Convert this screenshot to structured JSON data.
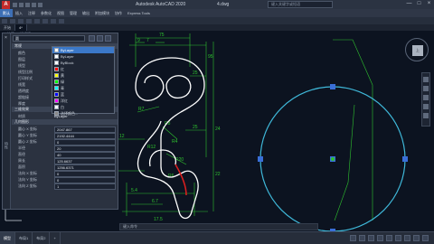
{
  "window": {
    "logo": "A",
    "title": "Autodesk AutoCAD 2020",
    "file": "4.dwg",
    "search_placeholder": "键入关键字或短语",
    "minimize": "—",
    "maximize": "□",
    "close": "×"
  },
  "menu": {
    "items": [
      "默认",
      "插入",
      "注释",
      "参数化",
      "视图",
      "管理",
      "输出",
      "附加模块",
      "协作",
      "Express Tools"
    ],
    "active_index": 0
  },
  "doc_tabs": [
    {
      "label": "开始",
      "active": false
    },
    {
      "label": "4*",
      "active": true
    }
  ],
  "viewport_label": "[-][俯视][二维线框]",
  "properties": {
    "close": "×",
    "side_title": "特性",
    "selection": "圆",
    "sections": {
      "general": "常规",
      "threed": "三维效果",
      "geometry": "几何图形"
    },
    "general_rows": [
      {
        "key": "颜色",
        "value": "ByLayer"
      },
      {
        "key": "图层",
        "value": ""
      },
      {
        "key": "线型",
        "value": ""
      },
      {
        "key": "线型比例",
        "value": ""
      },
      {
        "key": "打印样式",
        "value": ""
      },
      {
        "key": "线宽",
        "value": ""
      },
      {
        "key": "透明度",
        "value": ""
      },
      {
        "key": "超链接",
        "value": ""
      },
      {
        "key": "厚度",
        "value": ""
      }
    ],
    "threed_rows": [
      {
        "key": "材质",
        "value": "ByLayer"
      }
    ],
    "geometry_rows": [
      {
        "key": "圆心 X 坐标",
        "value": "2047.867"
      },
      {
        "key": "圆心 Y 坐标",
        "value": "2192.4444"
      },
      {
        "key": "圆心 Z 坐标",
        "value": "0"
      },
      {
        "key": "半径",
        "value": "20"
      },
      {
        "key": "直径",
        "value": "40"
      },
      {
        "key": "周长",
        "value": "125.6637"
      },
      {
        "key": "面积",
        "value": "1256.6371"
      },
      {
        "key": "法向 X 坐标",
        "value": "0"
      },
      {
        "key": "法向 Y 坐标",
        "value": "0"
      },
      {
        "key": "法向 Z 坐标",
        "value": "1"
      }
    ]
  },
  "color_dropdown": {
    "options": [
      {
        "label": "ByLayer",
        "color": "#ffffff",
        "highlight": true
      },
      {
        "label": "ByLayer",
        "color": "#ffffff",
        "highlight": false
      },
      {
        "label": "ByBlock",
        "color": "#ffffff",
        "highlight": false
      },
      {
        "label": "红",
        "color": "#ff0000",
        "highlight": false
      },
      {
        "label": "黄",
        "color": "#ffff00",
        "highlight": false
      },
      {
        "label": "绿",
        "color": "#00ff00",
        "highlight": false
      },
      {
        "label": "青",
        "color": "#00ffff",
        "highlight": false
      },
      {
        "label": "蓝",
        "color": "#0000ff",
        "highlight": false
      },
      {
        "label": "洋红",
        "color": "#ff00ff",
        "highlight": false
      },
      {
        "label": "白",
        "color": "#ffffff",
        "highlight": false
      },
      {
        "label": "选择颜色...",
        "color": "#888888",
        "highlight": false
      }
    ]
  },
  "drawing": {
    "dims": {
      "d75": "75",
      "d95": "95",
      "d9": "9",
      "d7": "7",
      "d25a": "25",
      "d25b": "25",
      "d24": "24",
      "d22": "22",
      "dR7": "R7",
      "dR8": "R8",
      "dR4": "R4",
      "dR12": "R12",
      "dR20": "R20",
      "dR6": "R6",
      "d54": "5.4",
      "d67": "6.7",
      "d175": "17.5",
      "d12": "12",
      "d4": "4",
      "d5": "5"
    },
    "colors": {
      "background": "#0c1320",
      "dimension": "#2fc22f",
      "outline": "#ffffff",
      "circle": "#3fb8d9",
      "selection_arc": "#d81f1f",
      "grip": "#3a6fd8"
    }
  },
  "viewcube": {
    "face": "上",
    "wcs": "WCS"
  },
  "status": {
    "tabs": [
      {
        "label": "模型",
        "active": true
      },
      {
        "label": "布局1",
        "active": false
      },
      {
        "label": "布局2",
        "active": false
      }
    ],
    "add": "+",
    "cmd_placeholder": "键入命令"
  }
}
